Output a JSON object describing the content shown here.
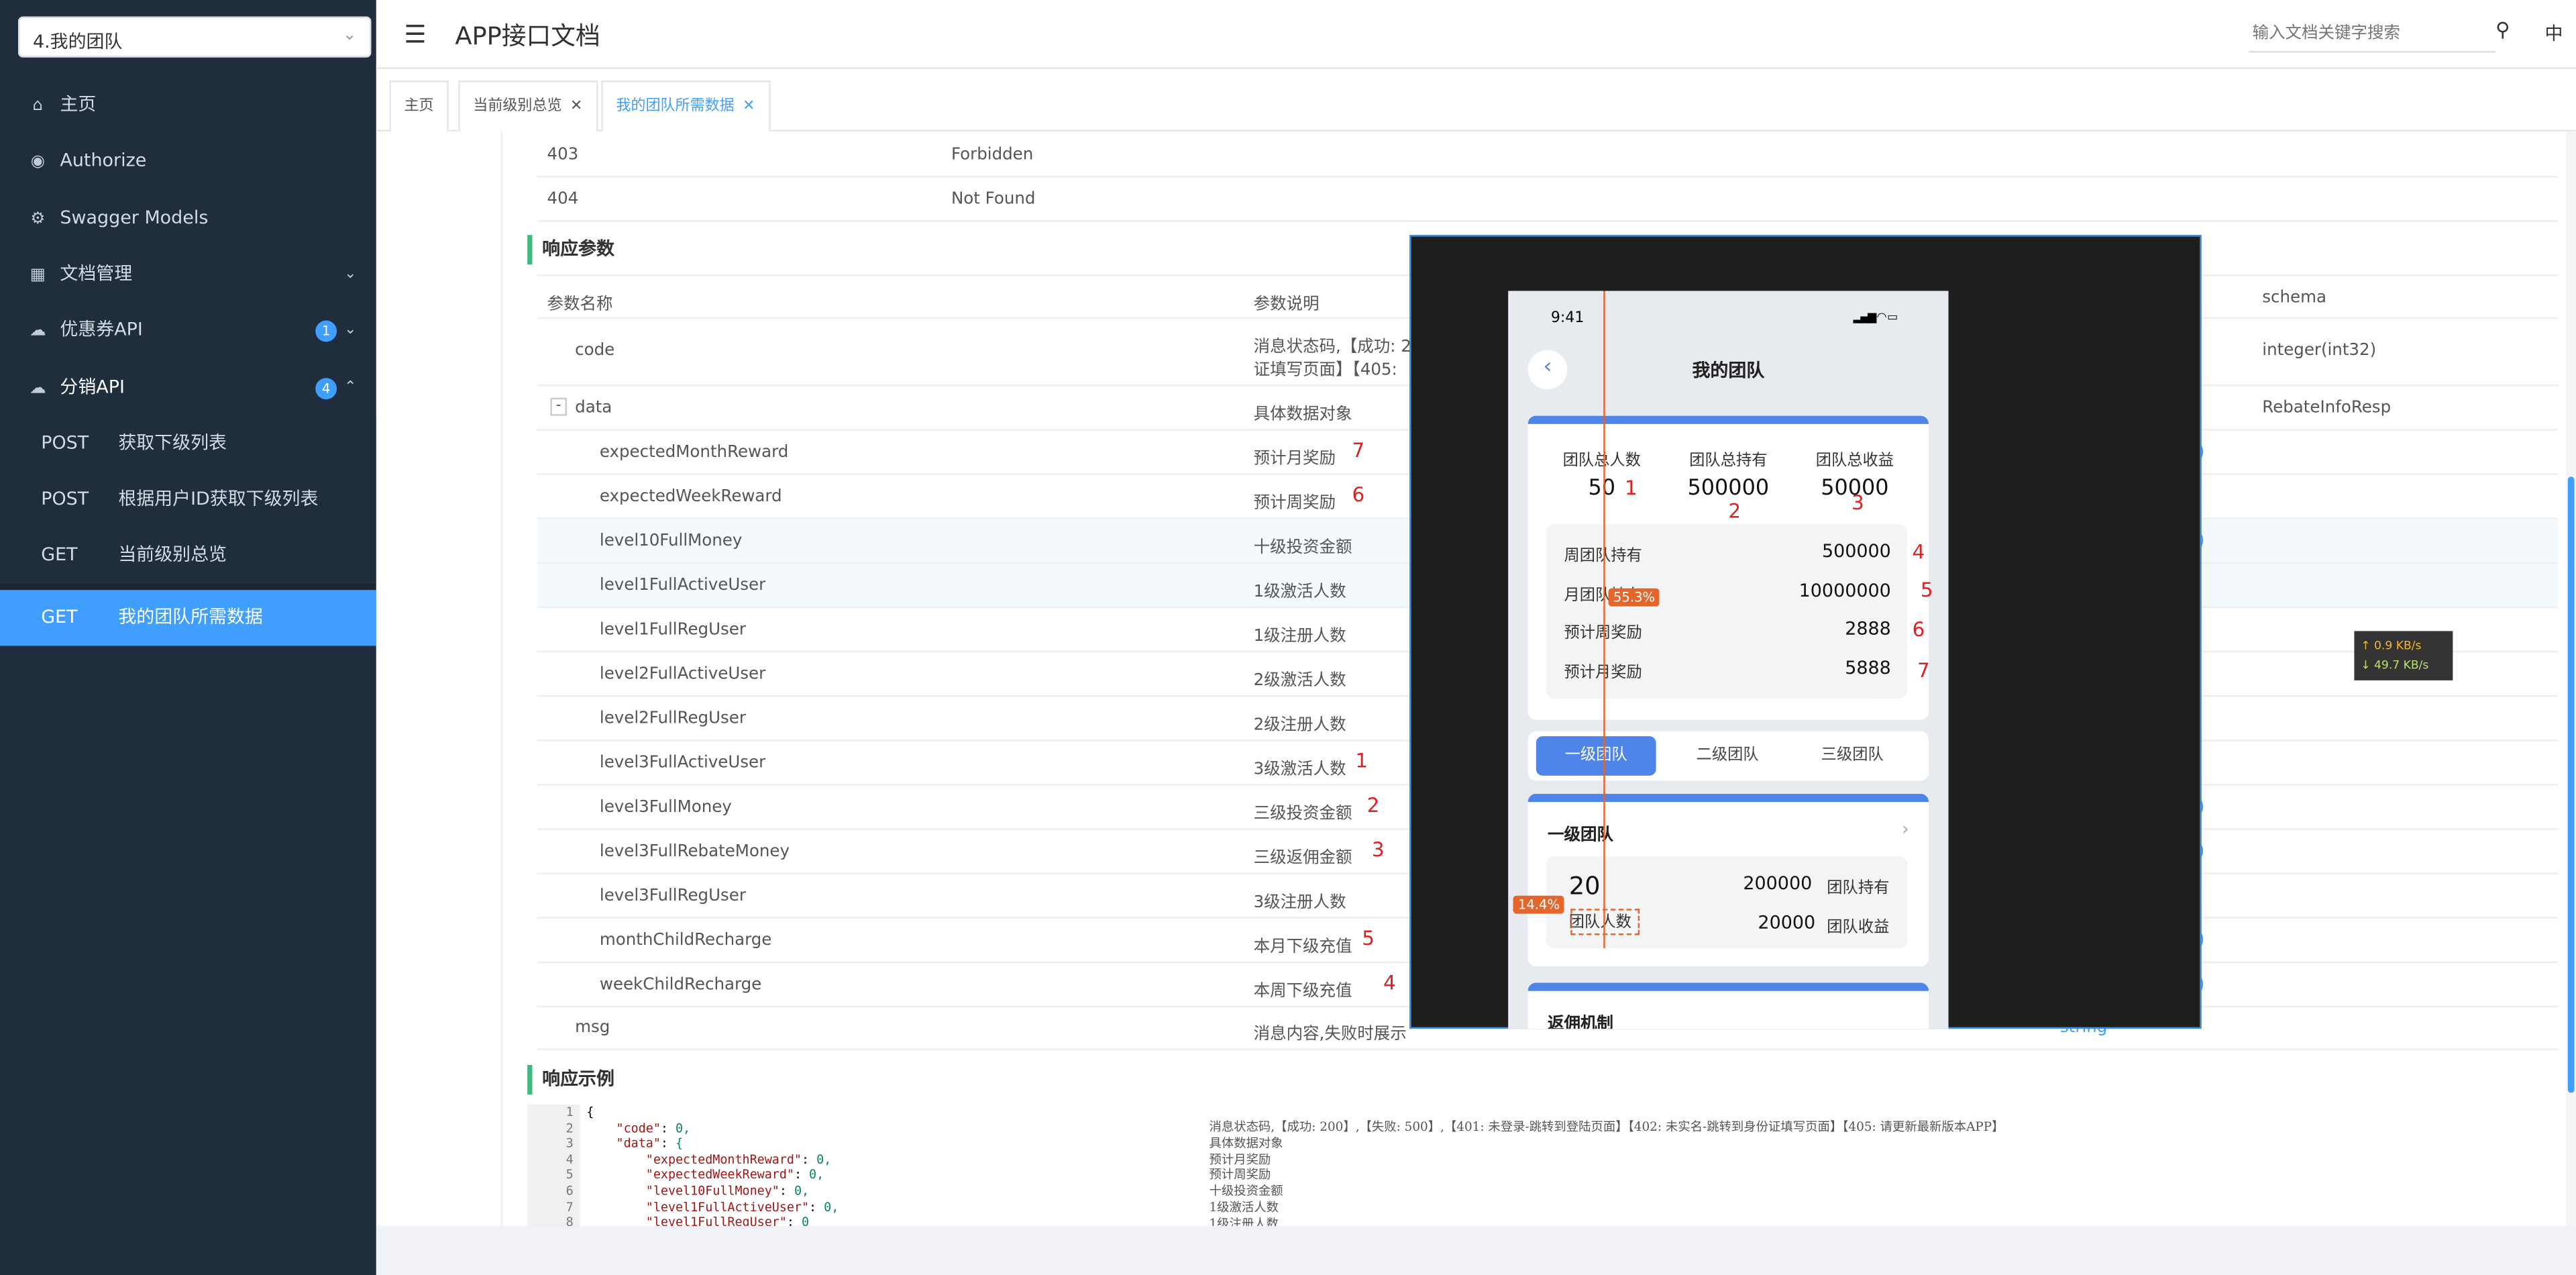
{
  "sidebar": {
    "select_value": "4.我的团队",
    "items": [
      {
        "label": "主页",
        "icon": "home-icon"
      },
      {
        "label": "Authorize",
        "icon": "lock-icon"
      },
      {
        "label": "Swagger Models",
        "icon": "gear-icon"
      },
      {
        "label": "文档管理",
        "icon": "document-icon"
      },
      {
        "label": "优惠券API",
        "icon": "cloud-icon",
        "badge": "1"
      },
      {
        "label": "分销API",
        "icon": "cloud-icon",
        "badge": "4"
      }
    ],
    "sub_items": [
      {
        "method": "POST",
        "label": "获取下级列表"
      },
      {
        "method": "POST",
        "label": "根据用户ID获取下级列表"
      },
      {
        "method": "GET",
        "label": "当前级别总览"
      },
      {
        "method": "GET",
        "label": "我的团队所需数据"
      }
    ]
  },
  "header": {
    "title": "APP接口文档",
    "search_placeholder": "输入文档关键字搜索",
    "lang": "中"
  },
  "tabs": [
    {
      "label": "主页"
    },
    {
      "label": "当前级别总览"
    },
    {
      "label": "我的团队所需数据"
    }
  ],
  "status_rows": [
    {
      "code": "403",
      "desc": "Forbidden"
    },
    {
      "code": "404",
      "desc": "Not Found"
    }
  ],
  "response_params": {
    "title": "响应参数",
    "headers": {
      "name": "参数名称",
      "desc": "参数说明",
      "schema": "schema"
    },
    "rows": [
      {
        "name": "code",
        "desc": "消息状态码,【成功: 2",
        "desc2": "证填写页面】【405:",
        "schema": "integer(int32)"
      },
      {
        "name": "data",
        "desc": "具体数据对象",
        "schema": "RebateInfoResp",
        "toggle": "-"
      },
      {
        "name": "expectedMonthReward",
        "desc": "预计月奖励",
        "mark": "7",
        "schema": ")"
      },
      {
        "name": "expectedWeekReward",
        "desc": "预计周奖励",
        "mark": "6",
        "schema": ""
      },
      {
        "name": "level10FullMoney",
        "desc": "十级投资金额",
        "schema": ")"
      },
      {
        "name": "level1FullActiveUser",
        "desc": "1级激活人数",
        "schema": ""
      },
      {
        "name": "level1FullRegUser",
        "desc": "1级注册人数",
        "schema": ""
      },
      {
        "name": "level2FullActiveUser",
        "desc": "2级激活人数",
        "schema": ""
      },
      {
        "name": "level2FullRegUser",
        "desc": "2级注册人数",
        "schema": ""
      },
      {
        "name": "level3FullActiveUser",
        "desc": "3级激活人数",
        "mark": "1",
        "schema": ""
      },
      {
        "name": "level3FullMoney",
        "desc": "三级投资金额",
        "mark": "2",
        "schema": ")"
      },
      {
        "name": "level3FullRebateMoney",
        "desc": "三级返佣金额",
        "mark": "3",
        "schema": ")"
      },
      {
        "name": "level3FullRegUser",
        "desc": "3级注册人数",
        "schema": ""
      },
      {
        "name": "monthChildRecharge",
        "desc": "本月下级充值",
        "mark": "5",
        "schema": ")"
      },
      {
        "name": "weekChildRecharge",
        "desc": "本周下级充值",
        "mark": "4",
        "schema": ")"
      },
      {
        "name": "msg",
        "desc": "消息内容,失败时展示",
        "schema": "string"
      }
    ]
  },
  "response_example": {
    "title": "响应示例",
    "line_numbers": [
      "1",
      "2",
      "3",
      "4",
      "5",
      "6",
      "7",
      "8"
    ],
    "code": [
      {
        "t": "{"
      },
      {
        "k": "\"code\"",
        "v": "0,",
        "i": "    "
      },
      {
        "k": "\"data\"",
        "v": "{",
        "i": "    "
      },
      {
        "k": "\"expectedMonthReward\"",
        "v": "0,",
        "i": "        "
      },
      {
        "k": "\"expectedWeekReward\"",
        "v": "0,",
        "i": "        "
      },
      {
        "k": "\"level10FullMoney\"",
        "v": "0,",
        "i": "        "
      },
      {
        "k": "\"level1FullActiveUser\"",
        "v": "0,",
        "i": "        "
      },
      {
        "k": "\"level1FullRegUser\"",
        "v": "0",
        "i": "        "
      }
    ],
    "comments": [
      "消息状态码,【成功: 200】,【失败: 500】,【401: 未登录-跳转到登陆页面】【402: 未实名-跳转到身份证填写页面】【405: 请更新最新版本APP】",
      "具体数据对象",
      "预计月奖励",
      "预计周奖励",
      "十级投资金额",
      "1级激活人数",
      "1级注册人数"
    ]
  },
  "phone": {
    "time": "9:41",
    "title": "我的团队",
    "stats": [
      {
        "label": "团队总人数",
        "value": "50",
        "mark": "1"
      },
      {
        "label": "团队总持有",
        "value": "500000",
        "mark": "2"
      },
      {
        "label": "团队总收益",
        "value": "50000",
        "mark": "3"
      }
    ],
    "details": [
      {
        "label": "周团队持有",
        "value": "500000",
        "mark": "4"
      },
      {
        "label": "月团队持有",
        "value": "10000000",
        "mark": "5"
      },
      {
        "label": "预计周奖励",
        "value": "2888",
        "mark": "6"
      },
      {
        "label": "预计月奖励",
        "value": "5888",
        "mark": "7"
      }
    ],
    "segments": [
      "一级团队",
      "二级团队",
      "三级团队"
    ],
    "team_card": {
      "title": "一级团队",
      "count": "20",
      "count_label": "团队人数",
      "hold_value": "200000",
      "hold_label": "团队持有",
      "earn_value": "20000",
      "earn_label": "团队收益"
    },
    "rebate_title": "返佣机制"
  },
  "measure": {
    "pct1": "55.3%",
    "pct2": "14.4%"
  },
  "net_speed": {
    "up": "↑ 0.9 KB/s",
    "down": "↓ 49.7 KB/s"
  }
}
